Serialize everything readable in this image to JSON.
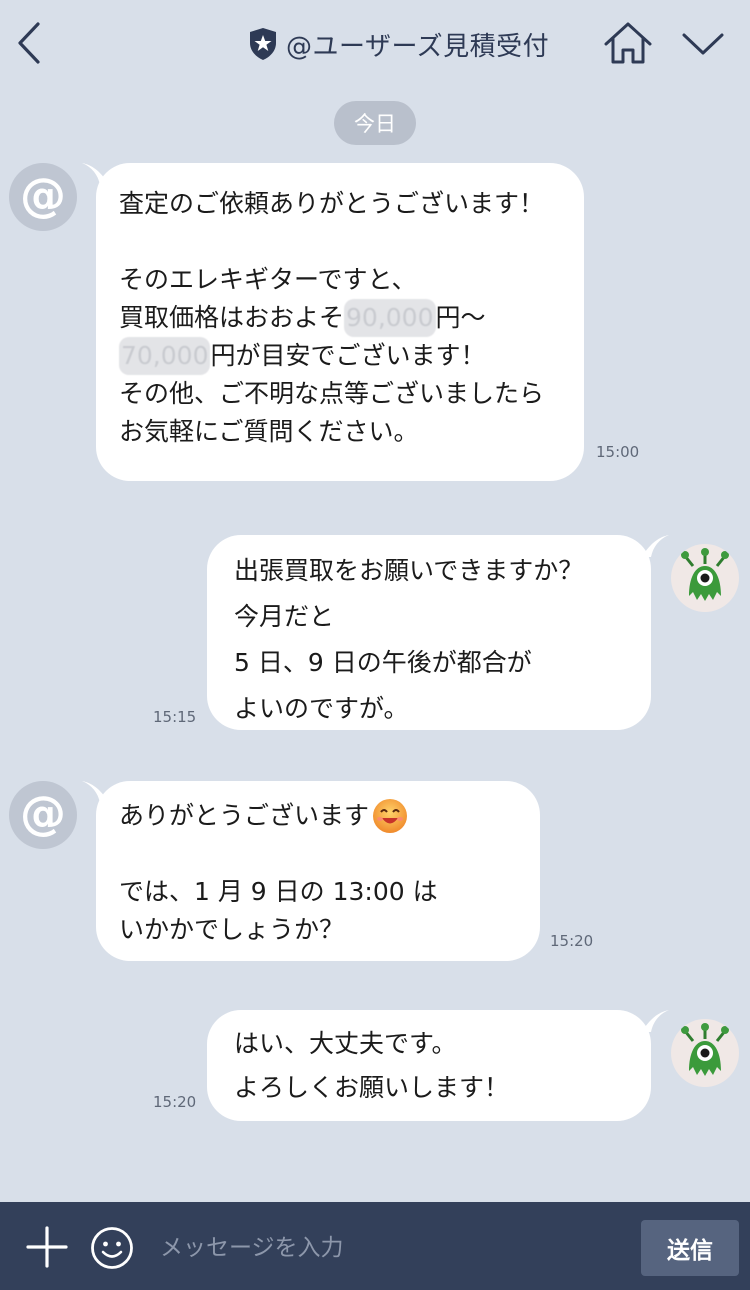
{
  "header": {
    "title": "@ユーザーズ見積受付"
  },
  "date_label": "今日",
  "messages": [
    {
      "sender": "official",
      "time": "15:00",
      "lines": [
        "査定のご依頼ありがとうございます！",
        "",
        "そのエレキギターですと、",
        "買取価格はおおよそ",
        "円〜",
        "円が目安でございます！",
        "その他、ご不明な点等ございましたら",
        "お気軽にご質問ください。"
      ],
      "blurred_price_low": "90,000",
      "blurred_price_high": "70,000"
    },
    {
      "sender": "user",
      "time": "15:15",
      "lines": [
        "出張買取をお願いできますか？",
        "今月だと",
        "5 日、9 日の午後が都合が",
        "よいのですが。"
      ]
    },
    {
      "sender": "official",
      "time": "15:20",
      "lines": [
        "ありがとうございます",
        "",
        "では、1 月 9 日の 13:00 は",
        "いかかでしょうか？"
      ],
      "emoji": "smiling-face-emoji"
    },
    {
      "sender": "user",
      "time": "15:20",
      "lines": [
        "はい、大丈夫です。",
        "よろしくお願いします！"
      ]
    }
  ],
  "input": {
    "placeholder": "メッセージを入力",
    "value": ""
  },
  "send_label": "送信",
  "icons": {
    "back": "chevron-left-icon",
    "shield": "shield-star-icon",
    "home": "home-icon",
    "menu": "chevron-down-icon",
    "plus": "plus-icon",
    "emoji": "smiley-icon"
  },
  "colors": {
    "background": "#d8dfe9",
    "bubble": "#ffffff",
    "input_bar": "#33405a",
    "send_button": "#56647f",
    "title": "#2e3a55"
  }
}
